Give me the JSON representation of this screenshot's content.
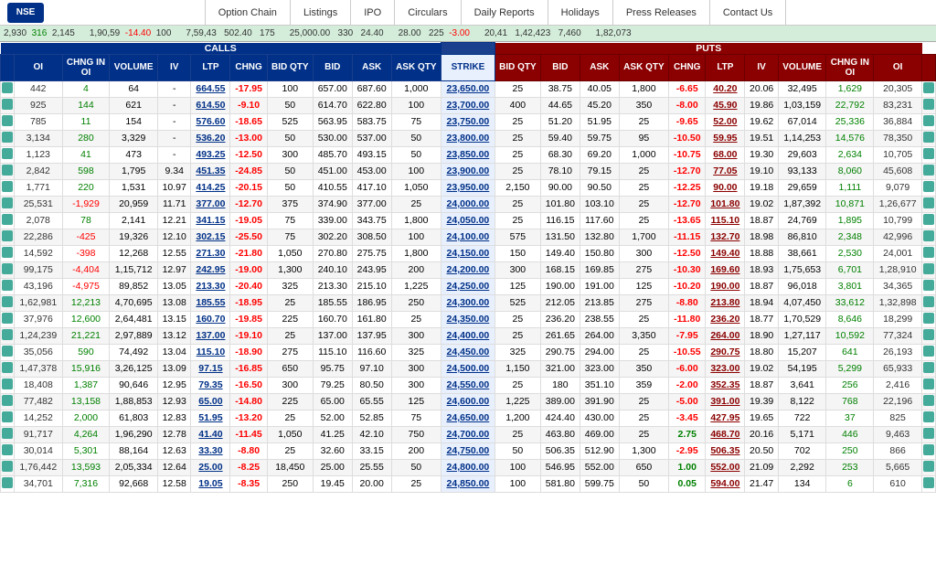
{
  "nav": {
    "logo": "NSE",
    "links": [
      "Option Chain",
      "Listings",
      "IPO",
      "Circulars",
      "Daily Reports",
      "Holidays",
      "Press Releases",
      "Contact Us"
    ]
  },
  "ticker": [
    {
      "label": "2,930",
      "change": "316",
      "value": "2,145"
    },
    {
      "label": "1,90,59",
      "change": "-14.40",
      "value": "100"
    },
    {
      "label": "7,59,43",
      "change": "502.40",
      "value": "175"
    },
    {
      "label": "25,000.00",
      "change": "330",
      "value": "24.40"
    },
    {
      "label": "28.00",
      "change": "225",
      "value": "-3.00"
    },
    {
      "label": "20,41",
      "change": "1,42,423",
      "value": "7,460"
    },
    {
      "label": "1,82,073"
    }
  ],
  "section_labels": {
    "calls": "CALLS",
    "puts": "PUTS"
  },
  "col_headers_calls": [
    "OI",
    "CHNG IN OI",
    "VOLUME",
    "IV",
    "LTP",
    "CHNG",
    "BID QTY",
    "BID",
    "ASK",
    "ASK QTY"
  ],
  "col_headers_strike": [
    "STRIKE"
  ],
  "col_headers_puts": [
    "BID QTY",
    "BID",
    "ASK",
    "ASK QTY",
    "CHNG",
    "LTP",
    "IV",
    "VOLUME",
    "CHNG IN OI",
    "OI"
  ],
  "rows": [
    {
      "oi": "442",
      "chng_oi": "4",
      "vol": "64",
      "iv": "-",
      "ltp": "664.55",
      "chng": "-17.95",
      "bid_qty": "100",
      "bid": "657.00",
      "ask": "687.60",
      "ask_qty": "1,000",
      "strike": "23,650.00",
      "p_bid_qty": "25",
      "p_bid": "38.75",
      "p_ask": "40.05",
      "p_ask_qty": "1,800",
      "p_chng": "-6.65",
      "p_ltp": "40.20",
      "p_iv": "20.06",
      "p_vol": "32,495",
      "p_chng_oi": "1,629",
      "p_oi": "20,305"
    },
    {
      "oi": "925",
      "chng_oi": "144",
      "vol": "621",
      "iv": "-",
      "ltp": "614.50",
      "chng": "-9.10",
      "bid_qty": "50",
      "bid": "614.70",
      "ask": "622.80",
      "ask_qty": "100",
      "strike": "23,700.00",
      "p_bid_qty": "400",
      "p_bid": "44.65",
      "p_ask": "45.20",
      "p_ask_qty": "350",
      "p_chng": "-8.00",
      "p_ltp": "45.90",
      "p_iv": "19.86",
      "p_vol": "1,03,159",
      "p_chng_oi": "22,792",
      "p_oi": "83,231"
    },
    {
      "oi": "785",
      "chng_oi": "11",
      "vol": "154",
      "iv": "-",
      "ltp": "576.60",
      "chng": "-18.65",
      "bid_qty": "525",
      "bid": "563.95",
      "ask": "583.75",
      "ask_qty": "75",
      "strike": "23,750.00",
      "p_bid_qty": "25",
      "p_bid": "51.20",
      "p_ask": "51.95",
      "p_ask_qty": "25",
      "p_chng": "-9.65",
      "p_ltp": "52.00",
      "p_iv": "19.62",
      "p_vol": "67,014",
      "p_chng_oi": "25,336",
      "p_oi": "36,884"
    },
    {
      "oi": "3,134",
      "chng_oi": "280",
      "vol": "3,329",
      "iv": "-",
      "ltp": "536.20",
      "chng": "-13.00",
      "bid_qty": "50",
      "bid": "530.00",
      "ask": "537.00",
      "ask_qty": "50",
      "strike": "23,800.00",
      "p_bid_qty": "25",
      "p_bid": "59.40",
      "p_ask": "59.75",
      "p_ask_qty": "95",
      "p_chng": "-10.50",
      "p_ltp": "59.95",
      "p_iv": "19.51",
      "p_vol": "1,14,253",
      "p_chng_oi": "14,576",
      "p_oi": "78,350"
    },
    {
      "oi": "1,123",
      "chng_oi": "41",
      "vol": "473",
      "iv": "-",
      "ltp": "493.25",
      "chng": "-12.50",
      "bid_qty": "300",
      "bid": "485.70",
      "ask": "493.15",
      "ask_qty": "50",
      "strike": "23,850.00",
      "p_bid_qty": "25",
      "p_bid": "68.30",
      "p_ask": "69.20",
      "p_ask_qty": "1,000",
      "p_chng": "-10.75",
      "p_ltp": "68.00",
      "p_iv": "19.30",
      "p_vol": "29,603",
      "p_chng_oi": "2,634",
      "p_oi": "10,705"
    },
    {
      "oi": "2,842",
      "chng_oi": "598",
      "vol": "1,795",
      "iv": "9.34",
      "ltp": "451.35",
      "chng": "-24.85",
      "bid_qty": "50",
      "bid": "451.00",
      "ask": "453.00",
      "ask_qty": "100",
      "strike": "23,900.00",
      "p_bid_qty": "25",
      "p_bid": "78.10",
      "p_ask": "79.15",
      "p_ask_qty": "25",
      "p_chng": "-12.70",
      "p_ltp": "77.05",
      "p_iv": "19.10",
      "p_vol": "93,133",
      "p_chng_oi": "8,060",
      "p_oi": "45,608"
    },
    {
      "oi": "1,771",
      "chng_oi": "220",
      "vol": "1,531",
      "iv": "10.97",
      "ltp": "414.25",
      "chng": "-20.15",
      "bid_qty": "50",
      "bid": "410.55",
      "ask": "417.10",
      "ask_qty": "1,050",
      "strike": "23,950.00",
      "p_bid_qty": "2,150",
      "p_bid": "90.00",
      "p_ask": "90.50",
      "p_ask_qty": "25",
      "p_chng": "-12.25",
      "p_ltp": "90.00",
      "p_iv": "19.18",
      "p_vol": "29,659",
      "p_chng_oi": "1,111",
      "p_oi": "9,079"
    },
    {
      "oi": "25,531",
      "chng_oi": "-1,929",
      "vol": "20,959",
      "iv": "11.71",
      "ltp": "377.00",
      "chng": "-12.70",
      "bid_qty": "375",
      "bid": "374.90",
      "ask": "377.00",
      "ask_qty": "25",
      "strike": "24,000.00",
      "p_bid_qty": "25",
      "p_bid": "101.80",
      "p_ask": "103.10",
      "p_ask_qty": "25",
      "p_chng": "-12.70",
      "p_ltp": "101.80",
      "p_iv": "19.02",
      "p_vol": "1,87,392",
      "p_chng_oi": "10,871",
      "p_oi": "1,26,677"
    },
    {
      "oi": "2,078",
      "chng_oi": "78",
      "vol": "2,141",
      "iv": "12.21",
      "ltp": "341.15",
      "chng": "-19.05",
      "bid_qty": "75",
      "bid": "339.00",
      "ask": "343.75",
      "ask_qty": "1,800",
      "strike": "24,050.00",
      "p_bid_qty": "25",
      "p_bid": "116.15",
      "p_ask": "117.60",
      "p_ask_qty": "25",
      "p_chng": "-13.65",
      "p_ltp": "115.10",
      "p_iv": "18.87",
      "p_vol": "24,769",
      "p_chng_oi": "1,895",
      "p_oi": "10,799"
    },
    {
      "oi": "22,286",
      "chng_oi": "-425",
      "vol": "19,326",
      "iv": "12.10",
      "ltp": "302.15",
      "chng": "-25.50",
      "bid_qty": "75",
      "bid": "302.20",
      "ask": "308.50",
      "ask_qty": "100",
      "strike": "24,100.00",
      "p_bid_qty": "575",
      "p_bid": "131.50",
      "p_ask": "132.80",
      "p_ask_qty": "1,700",
      "p_chng": "-11.15",
      "p_ltp": "132.70",
      "p_iv": "18.98",
      "p_vol": "86,810",
      "p_chng_oi": "2,348",
      "p_oi": "42,996"
    },
    {
      "oi": "14,592",
      "chng_oi": "-398",
      "vol": "12,268",
      "iv": "12.55",
      "ltp": "271.30",
      "chng": "-21.80",
      "bid_qty": "1,050",
      "bid": "270.80",
      "ask": "275.75",
      "ask_qty": "1,800",
      "strike": "24,150.00",
      "p_bid_qty": "150",
      "p_bid": "149.40",
      "p_ask": "150.80",
      "p_ask_qty": "300",
      "p_chng": "-12.50",
      "p_ltp": "149.40",
      "p_iv": "18.88",
      "p_vol": "38,661",
      "p_chng_oi": "2,530",
      "p_oi": "24,001"
    },
    {
      "oi": "99,175",
      "chng_oi": "-4,404",
      "vol": "1,15,712",
      "iv": "12.97",
      "ltp": "242.95",
      "chng": "-19.00",
      "bid_qty": "1,300",
      "bid": "240.10",
      "ask": "243.95",
      "ask_qty": "200",
      "strike": "24,200.00",
      "p_bid_qty": "300",
      "p_bid": "168.15",
      "p_ask": "169.85",
      "p_ask_qty": "275",
      "p_chng": "-10.30",
      "p_ltp": "169.60",
      "p_iv": "18.93",
      "p_vol": "1,75,653",
      "p_chng_oi": "6,701",
      "p_oi": "1,28,910"
    },
    {
      "oi": "43,196",
      "chng_oi": "-4,975",
      "vol": "89,852",
      "iv": "13.05",
      "ltp": "213.30",
      "chng": "-20.40",
      "bid_qty": "325",
      "bid": "213.30",
      "ask": "215.10",
      "ask_qty": "1,225",
      "strike": "24,250.00",
      "p_bid_qty": "125",
      "p_bid": "190.00",
      "p_ask": "191.00",
      "p_ask_qty": "125",
      "p_chng": "-10.20",
      "p_ltp": "190.00",
      "p_iv": "18.87",
      "p_vol": "96,018",
      "p_chng_oi": "3,801",
      "p_oi": "34,365"
    },
    {
      "oi": "1,62,981",
      "chng_oi": "12,213",
      "vol": "4,70,695",
      "iv": "13.08",
      "ltp": "185.55",
      "chng": "-18.95",
      "bid_qty": "25",
      "bid": "185.55",
      "ask": "186.95",
      "ask_qty": "250",
      "strike": "24,300.00",
      "p_bid_qty": "525",
      "p_bid": "212.05",
      "p_ask": "213.85",
      "p_ask_qty": "275",
      "p_chng": "-8.80",
      "p_ltp": "213.80",
      "p_iv": "18.94",
      "p_vol": "4,07,450",
      "p_chng_oi": "33,612",
      "p_oi": "1,32,898"
    },
    {
      "oi": "37,976",
      "chng_oi": "12,600",
      "vol": "2,64,481",
      "iv": "13.15",
      "ltp": "160.70",
      "chng": "-19.85",
      "bid_qty": "225",
      "bid": "160.70",
      "ask": "161.80",
      "ask_qty": "25",
      "strike": "24,350.00",
      "p_bid_qty": "25",
      "p_bid": "236.20",
      "p_ask": "238.55",
      "p_ask_qty": "25",
      "p_chng": "-11.80",
      "p_ltp": "236.20",
      "p_iv": "18.77",
      "p_vol": "1,70,529",
      "p_chng_oi": "8,646",
      "p_oi": "18,299"
    },
    {
      "oi": "1,24,239",
      "chng_oi": "21,221",
      "vol": "2,97,889",
      "iv": "13.12",
      "ltp": "137.00",
      "chng": "-19.10",
      "bid_qty": "25",
      "bid": "137.00",
      "ask": "137.95",
      "ask_qty": "300",
      "strike": "24,400.00",
      "p_bid_qty": "25",
      "p_bid": "261.65",
      "p_ask": "264.00",
      "p_ask_qty": "3,350",
      "p_chng": "-7.95",
      "p_ltp": "264.00",
      "p_iv": "18.90",
      "p_vol": "1,27,117",
      "p_chng_oi": "10,592",
      "p_oi": "77,324"
    },
    {
      "oi": "35,056",
      "chng_oi": "590",
      "vol": "74,492",
      "iv": "13.04",
      "ltp": "115.10",
      "chng": "-18.90",
      "bid_qty": "275",
      "bid": "115.10",
      "ask": "116.60",
      "ask_qty": "325",
      "strike": "24,450.00",
      "p_bid_qty": "325",
      "p_bid": "290.75",
      "p_ask": "294.00",
      "p_ask_qty": "25",
      "p_chng": "-10.55",
      "p_ltp": "290.75",
      "p_iv": "18.80",
      "p_vol": "15,207",
      "p_chng_oi": "641",
      "p_oi": "26,193"
    },
    {
      "oi": "1,47,378",
      "chng_oi": "15,916",
      "vol": "3,26,125",
      "iv": "13.09",
      "ltp": "97.15",
      "chng": "-16.85",
      "bid_qty": "650",
      "bid": "95.75",
      "ask": "97.10",
      "ask_qty": "300",
      "strike": "24,500.00",
      "p_bid_qty": "1,150",
      "p_bid": "321.00",
      "p_ask": "323.00",
      "p_ask_qty": "350",
      "p_chng": "-6.00",
      "p_ltp": "323.00",
      "p_iv": "19.02",
      "p_vol": "54,195",
      "p_chng_oi": "5,299",
      "p_oi": "65,933"
    },
    {
      "oi": "18,408",
      "chng_oi": "1,387",
      "vol": "90,646",
      "iv": "12.95",
      "ltp": "79.35",
      "chng": "-16.50",
      "bid_qty": "300",
      "bid": "79.25",
      "ask": "80.50",
      "ask_qty": "300",
      "strike": "24,550.00",
      "p_bid_qty": "25",
      "p_bid": "180",
      "p_ask": "351.10",
      "p_ask_qty": "359",
      "p_chng": "-2.00",
      "p_ltp": "352.35",
      "p_iv": "18.87",
      "p_vol": "3,641",
      "p_chng_oi": "256",
      "p_oi": "2,416"
    },
    {
      "oi": "77,482",
      "chng_oi": "13,158",
      "vol": "1,88,853",
      "iv": "12.93",
      "ltp": "65.00",
      "chng": "-14.80",
      "bid_qty": "225",
      "bid": "65.00",
      "ask": "65.55",
      "ask_qty": "125",
      "strike": "24,600.00",
      "p_bid_qty": "1,225",
      "p_bid": "389.00",
      "p_ask": "391.90",
      "p_ask_qty": "25",
      "p_chng": "-5.00",
      "p_ltp": "391.00",
      "p_iv": "19.39",
      "p_vol": "8,122",
      "p_chng_oi": "768",
      "p_oi": "22,196"
    },
    {
      "oi": "14,252",
      "chng_oi": "2,000",
      "vol": "61,803",
      "iv": "12.83",
      "ltp": "51.95",
      "chng": "-13.20",
      "bid_qty": "25",
      "bid": "52.00",
      "ask": "52.85",
      "ask_qty": "75",
      "strike": "24,650.00",
      "p_bid_qty": "1,200",
      "p_bid": "424.40",
      "p_ask": "430.00",
      "p_ask_qty": "25",
      "p_chng": "-3.45",
      "p_ltp": "427.95",
      "p_iv": "19.65",
      "p_vol": "722",
      "p_chng_oi": "37",
      "p_oi": "825"
    },
    {
      "oi": "91,717",
      "chng_oi": "4,264",
      "vol": "1,96,290",
      "iv": "12.78",
      "ltp": "41.40",
      "chng": "-11.45",
      "bid_qty": "1,050",
      "bid": "41.25",
      "ask": "42.10",
      "ask_qty": "750",
      "strike": "24,700.00",
      "p_bid_qty": "25",
      "p_bid": "463.80",
      "p_ask": "469.00",
      "p_ask_qty": "25",
      "p_chng": "2.75",
      "p_ltp": "468.70",
      "p_iv": "20.16",
      "p_vol": "5,171",
      "p_chng_oi": "446",
      "p_oi": "9,463"
    },
    {
      "oi": "30,014",
      "chng_oi": "5,301",
      "vol": "88,164",
      "iv": "12.63",
      "ltp": "33.30",
      "chng": "-8.80",
      "bid_qty": "25",
      "bid": "32.60",
      "ask": "33.15",
      "ask_qty": "200",
      "strike": "24,750.00",
      "p_bid_qty": "50",
      "p_bid": "506.35",
      "p_ask": "512.90",
      "p_ask_qty": "1,300",
      "p_chng": "-2.95",
      "p_ltp": "506.35",
      "p_iv": "20.50",
      "p_vol": "702",
      "p_chng_oi": "250",
      "p_oi": "866"
    },
    {
      "oi": "1,76,442",
      "chng_oi": "13,593",
      "vol": "2,05,334",
      "iv": "12.64",
      "ltp": "25.00",
      "chng": "-8.25",
      "bid_qty": "18,450",
      "bid": "25.00",
      "ask": "25.55",
      "ask_qty": "50",
      "strike": "24,800.00",
      "p_bid_qty": "100",
      "p_bid": "546.95",
      "p_ask": "552.00",
      "p_ask_qty": "650",
      "p_chng": "1.00",
      "p_ltp": "552.00",
      "p_iv": "21.09",
      "p_vol": "2,292",
      "p_chng_oi": "253",
      "p_oi": "5,665"
    },
    {
      "oi": "34,701",
      "chng_oi": "7,316",
      "vol": "92,668",
      "iv": "12.58",
      "ltp": "19.05",
      "chng": "-8.35",
      "bid_qty": "250",
      "bid": "19.45",
      "ask": "20.00",
      "ask_qty": "25",
      "strike": "24,850.00",
      "p_bid_qty": "100",
      "p_bid": "581.80",
      "p_ask": "599.75",
      "p_ask_qty": "50",
      "p_chng": "0.05",
      "p_ltp": "594.00",
      "p_iv": "21.47",
      "p_vol": "134",
      "p_chng_oi": "6",
      "p_oi": "610"
    }
  ]
}
